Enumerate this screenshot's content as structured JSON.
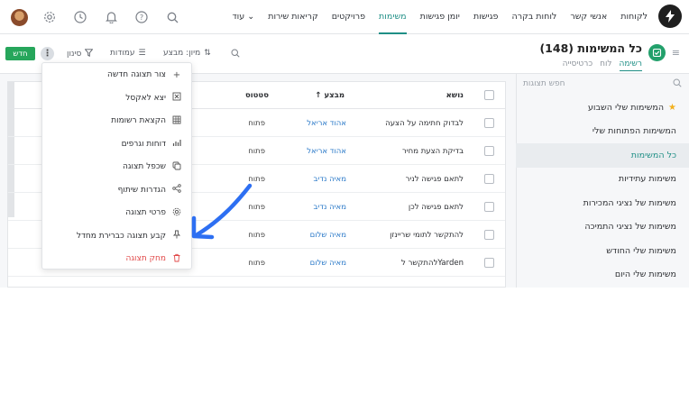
{
  "colors": {
    "accent": "#1f8f86",
    "new_button": "#26a65b",
    "assignee": "#2a79c8",
    "danger": "#e14a4a",
    "annotation_arrow": "#2d6ff2",
    "star": "#f2b01e"
  },
  "nav": {
    "items": [
      "לקוחות",
      "אנשי קשר",
      "לוחות בקרה",
      "פגישות",
      "יומן פגישות",
      "משימות",
      "פרויקטים",
      "קריאות שירות"
    ],
    "active_index": 5,
    "more_label": "עוד"
  },
  "top_icons": [
    "search-icon",
    "help-icon",
    "bell-icon",
    "clock-icon",
    "gear-icon",
    "avatar"
  ],
  "sidebar": {
    "title": "כל המשימות (148)",
    "views": [
      "רשימה",
      "לוח",
      "כרטיסייה"
    ],
    "active_view": 0,
    "search_placeholder": "חפש תצוגות",
    "items": [
      {
        "label": "המשימות שלי השבוע",
        "starred": true
      },
      {
        "label": "המשימות הפתוחות שלי",
        "starred": false
      },
      {
        "label": "כל המשימות",
        "starred": false,
        "active": true
      },
      {
        "label": "משימות עתידיות",
        "starred": false
      },
      {
        "label": "משימות של נציגי המכירות",
        "starred": false
      },
      {
        "label": "משימות של נציגי התמיכה",
        "starred": false
      },
      {
        "label": "משימות שלי החודש",
        "starred": false
      },
      {
        "label": "משימות שלי היום",
        "starred": false
      }
    ]
  },
  "toolbar": {
    "sort_label": "מיון: מבצע",
    "columns_label": "עמודות",
    "filter_label": "סינון",
    "new_label": "חדש",
    "more_label": "⋮"
  },
  "table": {
    "headers": {
      "subject": "נושא",
      "assignee": "↑ מבצע",
      "status": "סטטוס"
    },
    "rows": [
      {
        "subject": "לבדוק חתימה על הצעה",
        "assignee": "אהוד אריאל",
        "status": "פתוח"
      },
      {
        "subject": "בדיקת הצעת מחיר",
        "assignee": "אהוד אריאל",
        "status": "פתוח"
      },
      {
        "subject": "לתאם פגישה לניר",
        "assignee": "מאיה נדיב",
        "status": "פתוח"
      },
      {
        "subject": "לתאם פגישה לכן",
        "assignee": "מאיה נדיב",
        "status": "פתוח"
      },
      {
        "subject": "להתקשר לתומי שריינזן",
        "assignee": "מאיה שלום",
        "status": "פתוח"
      },
      {
        "subject": "להתקשר לYarden",
        "assignee": "מאיה שלום",
        "status": "פתוח"
      }
    ]
  },
  "menu": {
    "items": [
      {
        "label": "צור תצוגה חדשה",
        "icon": "plus-icon"
      },
      {
        "label": "יצא לאקסל",
        "icon": "excel-icon"
      },
      {
        "label": "הקצאת רשומות",
        "icon": "grid-icon"
      },
      {
        "label": "דוחות וגרפים",
        "icon": "chart-icon"
      },
      {
        "label": "שכפל תצוגה",
        "icon": "copy-icon"
      },
      {
        "label": "הגדרות שיתוף",
        "icon": "share-icon"
      },
      {
        "label": "פרטי תצוגה",
        "icon": "settings-icon"
      },
      {
        "label": "קבע תצוגה כברירת מחדל",
        "icon": "pin-icon"
      },
      {
        "label": "מחק תצוגה",
        "icon": "trash-icon",
        "danger": true
      }
    ]
  }
}
